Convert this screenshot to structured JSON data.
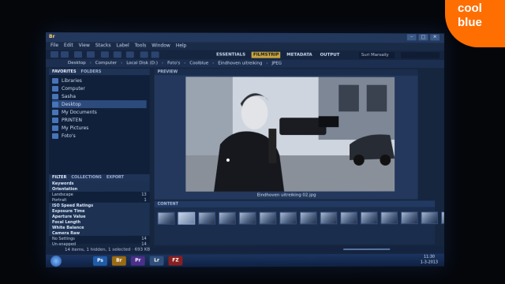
{
  "window": {
    "app_logo": "Br"
  },
  "menu": [
    "File",
    "Edit",
    "View",
    "Stacks",
    "Label",
    "Tools",
    "Window",
    "Help"
  ],
  "workspaces": {
    "items": [
      "ESSENTIALS",
      "FILMSTRIP",
      "METADATA",
      "OUTPUT"
    ],
    "active": "FILMSTRIP"
  },
  "user_field": "Suri Marsaily",
  "path": [
    "Desktop",
    "Computer",
    "Local Disk (D:)",
    "Foto's",
    "Coolblue",
    "Eindhoven uitreiking",
    "JPEG"
  ],
  "left_panel": {
    "tabs": [
      "FAVORITES",
      "FOLDERS"
    ],
    "favorites": [
      "Libraries",
      "Computer",
      "Sasha",
      "Desktop",
      "My Documents",
      "PRINTEN",
      "My Pictures",
      "Foto's"
    ],
    "filter_tabs": [
      "FILTER",
      "COLLECTIONS",
      "EXPORT"
    ],
    "filters": [
      {
        "label": "Keywords",
        "heading": true,
        "count": ""
      },
      {
        "label": "Orientation",
        "heading": true,
        "count": ""
      },
      {
        "label": "Landscape",
        "heading": false,
        "count": "13"
      },
      {
        "label": "Portrait",
        "heading": false,
        "count": "1"
      },
      {
        "label": "ISO Speed Ratings",
        "heading": true,
        "count": ""
      },
      {
        "label": "Exposure Time",
        "heading": true,
        "count": ""
      },
      {
        "label": "Aperture Value",
        "heading": true,
        "count": ""
      },
      {
        "label": "Focal Length",
        "heading": true,
        "count": ""
      },
      {
        "label": "White Balance",
        "heading": true,
        "count": ""
      },
      {
        "label": "Camera Raw",
        "heading": true,
        "count": ""
      },
      {
        "label": "No Settings",
        "heading": false,
        "count": "14"
      },
      {
        "label": "Un-snapped",
        "heading": false,
        "count": "14"
      }
    ]
  },
  "preview": {
    "header": "PREVIEW",
    "caption": "Eindhoven uitreiking 02.jpg"
  },
  "content": {
    "header": "CONTENT",
    "thumb_count": 16,
    "selected_index": 1
  },
  "status": {
    "text": "14 items, 1 hidden, 1 selected · 693 KB"
  },
  "taskbar": {
    "apps": [
      {
        "label": "Ps",
        "color": "#1f5ca8"
      },
      {
        "label": "Br",
        "color": "#9a6b12"
      },
      {
        "label": "Pr",
        "color": "#4b2f8a"
      },
      {
        "label": "Lr",
        "color": "#2f4f7a"
      },
      {
        "label": "FZ",
        "color": "#8a1f1f"
      }
    ],
    "clock": {
      "time": "11:30",
      "date": "1-3-2013"
    }
  },
  "brand": {
    "line1": "cool",
    "line2": "blue",
    "color": "#ff6e00"
  }
}
